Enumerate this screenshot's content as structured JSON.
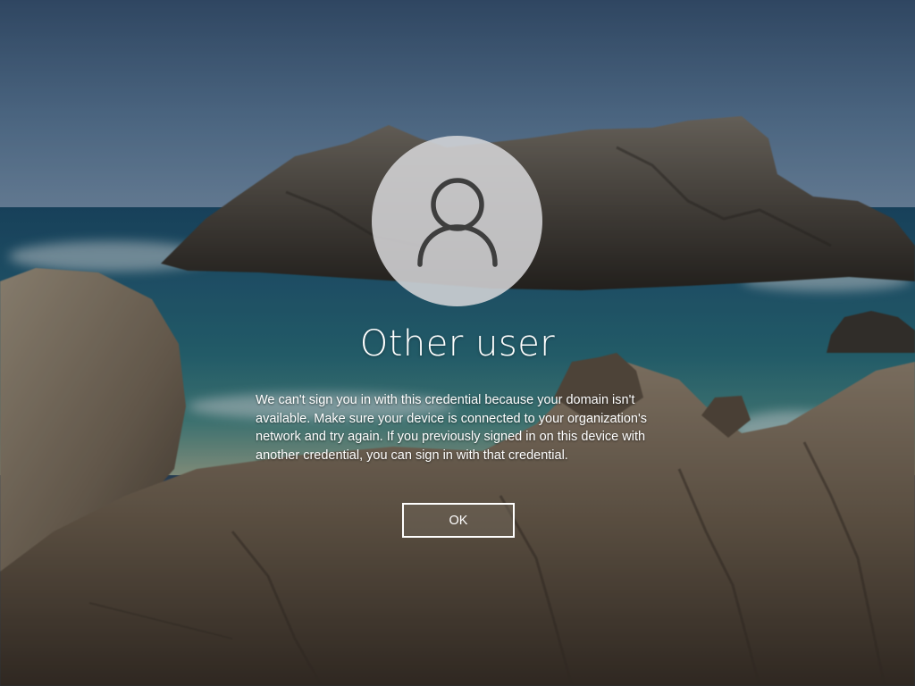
{
  "login": {
    "username": "Other user",
    "message": "We can't sign you in with this credential because your domain isn't available. Make sure your device is connected to your organization's network and try again. If you previously signed in on this device with another credential, you can sign in with that credential.",
    "ok_label": "OK",
    "avatar_icon": "user-silhouette-icon"
  },
  "background": {
    "scene": "rocky coast seascape",
    "colors": {
      "sky": "#4f6f90",
      "sea": "#25607a",
      "rock": "#6a5d4d"
    }
  }
}
